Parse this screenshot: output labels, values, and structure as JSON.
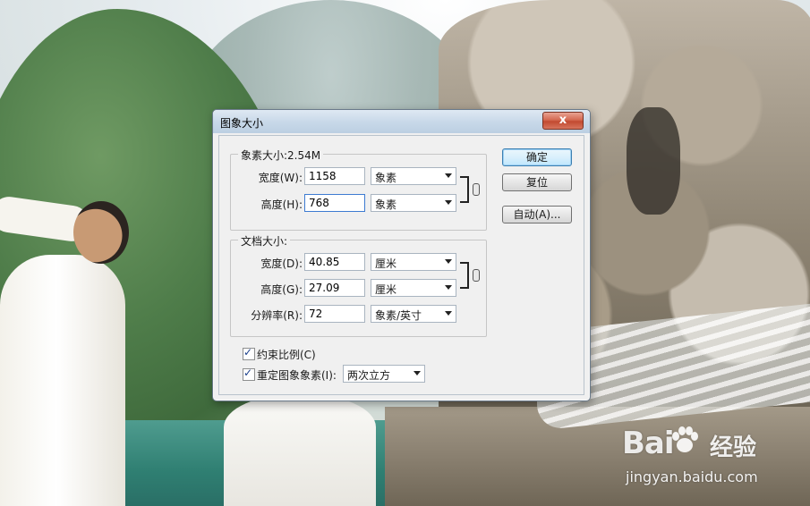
{
  "dialog": {
    "title": "图象大小",
    "close_label": "x"
  },
  "pixel_dims": {
    "legend": "象素大小:2.54M",
    "width_label": "宽度(W):",
    "width_value": "1158",
    "width_unit": "象素",
    "height_label": "高度(H):",
    "height_value": "768",
    "height_unit": "象素"
  },
  "doc_size": {
    "legend": "文档大小:",
    "width_label": "宽度(D):",
    "width_value": "40.85",
    "width_unit": "厘米",
    "height_label": "高度(G):",
    "height_value": "27.09",
    "height_unit": "厘米",
    "resolution_label": "分辨率(R):",
    "resolution_value": "72",
    "resolution_unit": "象素/英寸"
  },
  "buttons": {
    "ok": "确定",
    "reset": "复位",
    "auto": "自动(A)..."
  },
  "options": {
    "constrain_label": "约束比例(C)",
    "constrain_checked": true,
    "resample_label": "重定图象象素(I):",
    "resample_checked": true,
    "resample_method": "两次立方"
  },
  "watermark": {
    "logo": "Bai",
    "logo_suffix": "经验",
    "url": "jingyan.baidu.com"
  }
}
